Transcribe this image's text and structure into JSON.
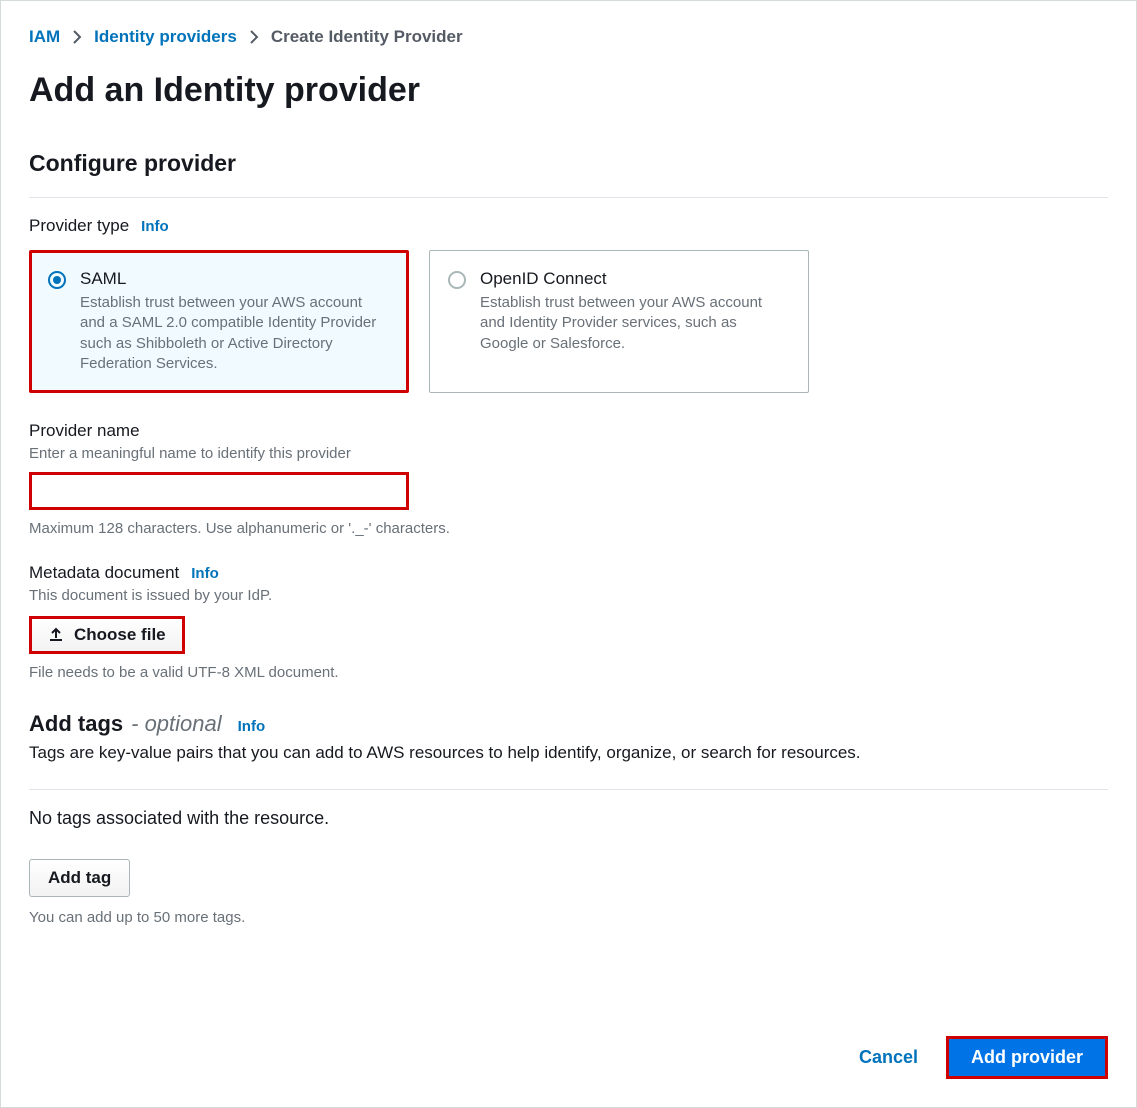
{
  "breadcrumb": {
    "items": [
      {
        "label": "IAM",
        "link": true
      },
      {
        "label": "Identity providers",
        "link": true
      },
      {
        "label": "Create Identity Provider",
        "link": false
      }
    ]
  },
  "page_title": "Add an Identity provider",
  "configure": {
    "heading": "Configure provider",
    "provider_type_label": "Provider type",
    "info_label": "Info",
    "options": {
      "saml": {
        "title": "SAML",
        "desc": "Establish trust between your AWS account and a SAML 2.0 compatible Identity Provider such as Shibboleth or Active Directory Federation Services.",
        "selected": true
      },
      "oidc": {
        "title": "OpenID Connect",
        "desc": "Establish trust between your AWS account and Identity Provider services, such as Google or Salesforce.",
        "selected": false
      }
    },
    "provider_name": {
      "label": "Provider name",
      "sub": "Enter a meaningful name to identify this provider",
      "value": "",
      "hint": "Maximum 128 characters. Use alphanumeric or '._-' characters."
    },
    "metadata": {
      "label": "Metadata document",
      "sub": "This document is issued by your IdP.",
      "button": "Choose file",
      "hint": "File needs to be a valid UTF-8 XML document."
    }
  },
  "tags": {
    "heading": "Add tags",
    "optional": "- optional",
    "info_label": "Info",
    "desc": "Tags are key-value pairs that you can add to AWS resources to help identify, organize, or search for resources.",
    "empty": "No tags associated with the resource.",
    "add_button": "Add tag",
    "hint": "You can add up to 50 more tags."
  },
  "footer": {
    "cancel": "Cancel",
    "submit": "Add provider"
  }
}
